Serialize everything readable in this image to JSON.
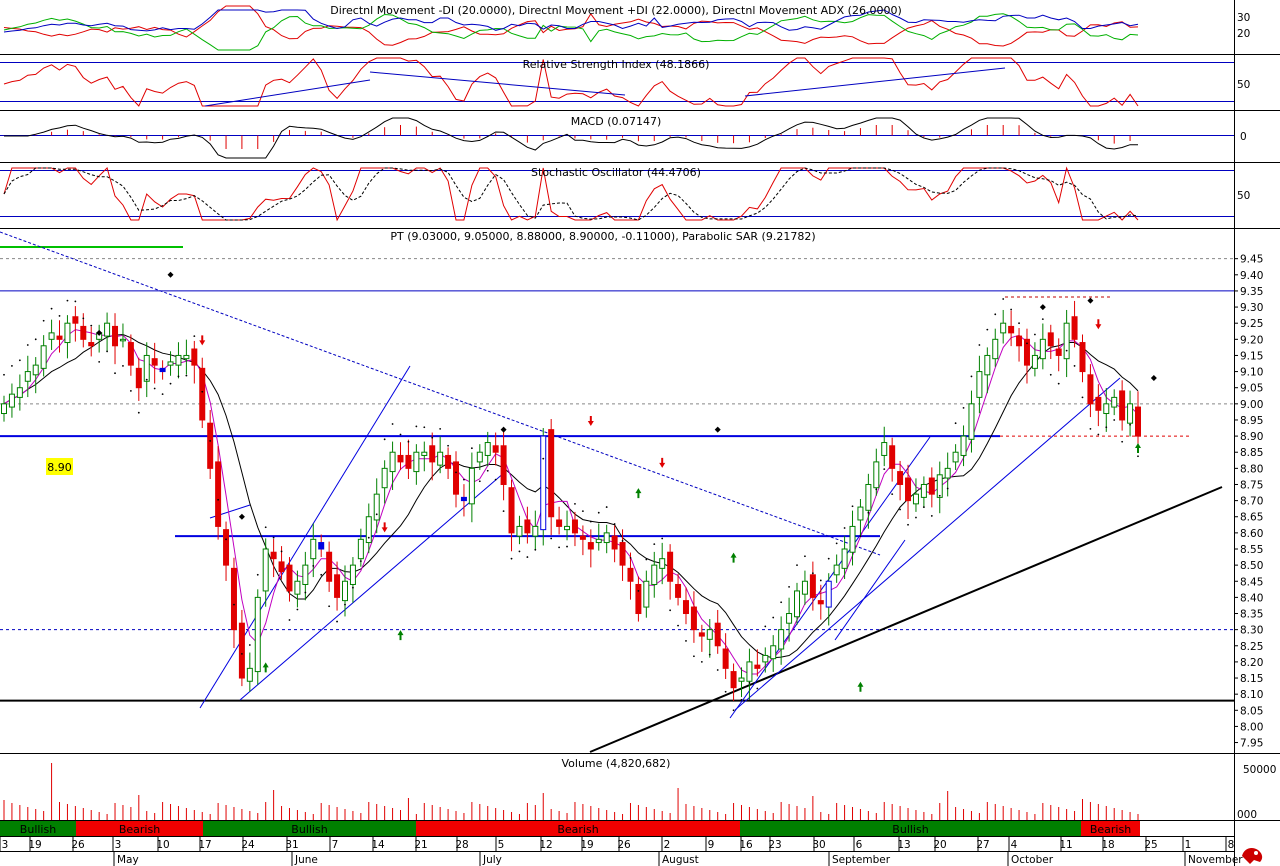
{
  "panels": {
    "dmi": {
      "title": "Directnl Movement -DI (20.0000), Directnl Movement +DI (22.0000), Directnl Movement ADX (26.0000)",
      "ticks": [
        "30",
        "20"
      ],
      "series_colors": {
        "minus_di": "#e00000",
        "plus_di": "#00b000",
        "adx": "#0000c0"
      }
    },
    "rsi": {
      "title": "Relative Strength Index (48.1866)",
      "ticks": [
        "50"
      ],
      "color": "#e00000"
    },
    "macd": {
      "title": "MACD (0.07147)",
      "ticks": [
        "0"
      ],
      "color": "#e00000"
    },
    "stoch": {
      "title": "Stochastic Oscillator (44.4706)",
      "ticks": [
        "50"
      ],
      "color": "#e00000"
    },
    "price": {
      "title": "PT (9.03000, 9.05000, 8.88000, 8.90000, -0.11000), Parabolic SAR (9.21782)",
      "ticks": [
        "9.45",
        "9.40",
        "9.35",
        "9.30",
        "9.25",
        "9.20",
        "9.15",
        "9.10",
        "9.05",
        "9.00",
        "8.95",
        "8.90",
        "8.85",
        "8.80",
        "8.75",
        "8.70",
        "8.65",
        "8.60",
        "8.55",
        "8.50",
        "8.45",
        "8.40",
        "8.35",
        "8.30",
        "8.25",
        "8.20",
        "8.15",
        "8.10",
        "8.05",
        "8.00",
        "7.95"
      ],
      "last_price_label": "8.90",
      "colors": {
        "up": "#008000",
        "down": "#e00000",
        "blue": "#0000e0",
        "sma_fast": "#c000c0",
        "sma_slow": "#000000",
        "sar": "#000000"
      }
    },
    "volume": {
      "title": "Volume (4,820,682)",
      "ticks": [
        "50000",
        "000"
      ],
      "color": "#e00000"
    }
  },
  "trend_band": [
    {
      "label": "Bullish",
      "state": "bull"
    },
    {
      "label": "Bearish",
      "state": "bear"
    },
    {
      "label": "Bullish",
      "state": "bull"
    },
    {
      "label": "Bearish",
      "state": "bear"
    },
    {
      "label": "Bullish",
      "state": "bull"
    },
    {
      "label": "Bearish",
      "state": "bear"
    }
  ],
  "band_colors": {
    "bull": "#008000",
    "bear": "#f00000"
  },
  "date_axis": {
    "days": [
      "3",
      "19",
      "26",
      "3",
      "10",
      "17",
      "24",
      "31",
      "7",
      "14",
      "21",
      "28",
      "5",
      "12",
      "19",
      "26",
      "2",
      "9",
      "16",
      "23",
      "30",
      "6",
      "13",
      "20",
      "27",
      "4",
      "11",
      "18",
      "25",
      "1",
      "8"
    ],
    "months": [
      "May",
      "June",
      "July",
      "August",
      "September",
      "October",
      "November"
    ]
  },
  "chart_data": [
    {
      "type": "line",
      "title": "PT (9.03000, 9.05000, 8.88000, 8.90000, -0.11000), Parabolic SAR (9.21782)",
      "xlabel": "",
      "ylabel": "",
      "ylim": [
        7.93,
        9.48
      ],
      "last": {
        "open": 9.03,
        "high": 9.05,
        "low": 8.88,
        "close": 8.9,
        "change": -0.11
      },
      "parabolic_sar": 9.21782,
      "closes": [
        9.0,
        9.03,
        9.05,
        9.1,
        9.12,
        9.18,
        9.22,
        9.2,
        9.25,
        9.25,
        9.2,
        9.18,
        9.22,
        9.25,
        9.18,
        9.2,
        9.12,
        9.05,
        9.15,
        9.12,
        9.1,
        9.13,
        9.15,
        9.15,
        9.12,
        8.95,
        8.8,
        8.62,
        8.5,
        8.3,
        8.15,
        8.18,
        8.4,
        8.55,
        8.52,
        8.48,
        8.42,
        8.45,
        8.5,
        8.58,
        8.55,
        8.45,
        8.4,
        8.45,
        8.5,
        8.58,
        8.65,
        8.72,
        8.8,
        8.85,
        8.82,
        8.8,
        8.85,
        8.85,
        8.82,
        8.85,
        8.8,
        8.72,
        8.7,
        8.8,
        8.85,
        8.88,
        8.85,
        8.75,
        8.6,
        8.62,
        8.6,
        8.62,
        8.9,
        8.65,
        8.62,
        8.62,
        8.6,
        8.58,
        8.55,
        8.58,
        8.6,
        8.55,
        8.5,
        8.45,
        8.35,
        8.45,
        8.5,
        8.52,
        8.45,
        8.4,
        8.35,
        8.3,
        8.28,
        8.3,
        8.25,
        8.18,
        8.12,
        8.15,
        8.2,
        8.18,
        8.22,
        8.25,
        8.3,
        8.35,
        8.42,
        8.45,
        8.4,
        8.38,
        8.45,
        8.5,
        8.55,
        8.62,
        8.68,
        8.75,
        8.82,
        8.88,
        8.8,
        8.75,
        8.7,
        8.72,
        8.75,
        8.72,
        8.78,
        8.8,
        8.85,
        8.9,
        9.0,
        9.1,
        9.15,
        9.2,
        9.25,
        9.22,
        9.18,
        9.12,
        9.15,
        9.2,
        9.18,
        9.15,
        9.25,
        9.2,
        9.1,
        9.0,
        8.98,
        9.0,
        9.02,
        8.95,
        9.0,
        8.9
      ],
      "support_resistance": [
        9.35,
        8.9,
        8.59,
        8.3,
        8.08
      ]
    },
    {
      "type": "bar",
      "title": "Volume (4,820,682)",
      "xlabel": "",
      "ylabel": "",
      "values": [
        4820682
      ]
    }
  ]
}
